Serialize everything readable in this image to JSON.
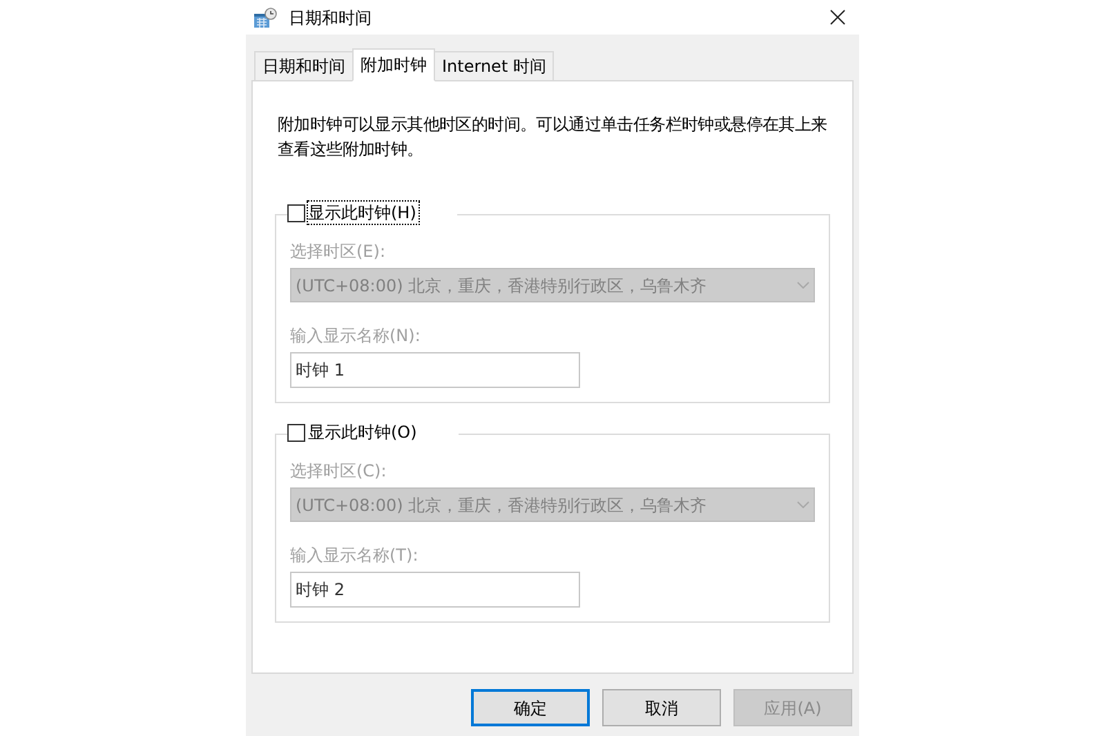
{
  "window": {
    "title": "日期和时间"
  },
  "tabs": [
    {
      "label": "日期和时间",
      "selected": false
    },
    {
      "label": "附加时钟",
      "selected": true
    },
    {
      "label": "Internet 时间",
      "selected": false
    }
  ],
  "description": "附加时钟可以显示其他时区的时间。可以通过单击任务栏时钟或悬停在其上来查看这些附加时钟。",
  "clocks": [
    {
      "checkbox": {
        "label": "显示此时钟(H)",
        "checked": false,
        "focused": true
      },
      "disabled": true,
      "timezone_label": "选择时区(E):",
      "timezone": "(UTC+08:00) 北京，重庆，香港特别行政区，乌鲁木齐",
      "name_label": "输入显示名称(N):",
      "name_value": "时钟 1"
    },
    {
      "checkbox": {
        "label": "显示此时钟(O)",
        "checked": false,
        "focused": false
      },
      "disabled": true,
      "timezone_label": "选择时区(C):",
      "timezone": "(UTC+08:00) 北京，重庆，香港特别行政区，乌鲁木齐",
      "name_label": "输入显示名称(T):",
      "name_value": "时钟 2"
    }
  ],
  "buttons": [
    {
      "label": "确定",
      "default": true,
      "disabled": false
    },
    {
      "label": "取消",
      "default": false,
      "disabled": false
    },
    {
      "label": "应用(A)",
      "default": false,
      "disabled": true
    }
  ]
}
